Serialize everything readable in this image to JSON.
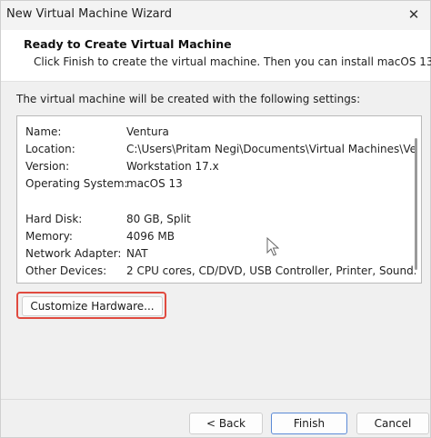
{
  "window": {
    "title": "New Virtual Machine Wizard",
    "close_glyph": "✕"
  },
  "header": {
    "title": "Ready to Create Virtual Machine",
    "subtitle": "Click Finish to create the virtual machine. Then you can install macOS 13."
  },
  "intro_text": "The virtual machine will be created with the following settings:",
  "settings": [
    {
      "label": "Name:",
      "value": "Ventura"
    },
    {
      "label": "Location:",
      "value": "C:\\Users\\Pritam Negi\\Documents\\Virtual Machines\\Ve..."
    },
    {
      "label": "Version:",
      "value": "Workstation 17.x"
    },
    {
      "label": "Operating System:",
      "value": "macOS 13"
    },
    {
      "label": "Hard Disk:",
      "value": "80 GB, Split"
    },
    {
      "label": "Memory:",
      "value": "4096 MB"
    },
    {
      "label": "Network Adapter:",
      "value": "NAT"
    },
    {
      "label": "Other Devices:",
      "value": "2 CPU cores, CD/DVD, USB Controller, Printer, Sound..."
    }
  ],
  "buttons": {
    "customize": "Customize Hardware...",
    "back": "< Back",
    "finish": "Finish",
    "cancel": "Cancel"
  },
  "colors": {
    "highlight": "#e04a3f",
    "default_button_border": "#5b8ad6"
  }
}
